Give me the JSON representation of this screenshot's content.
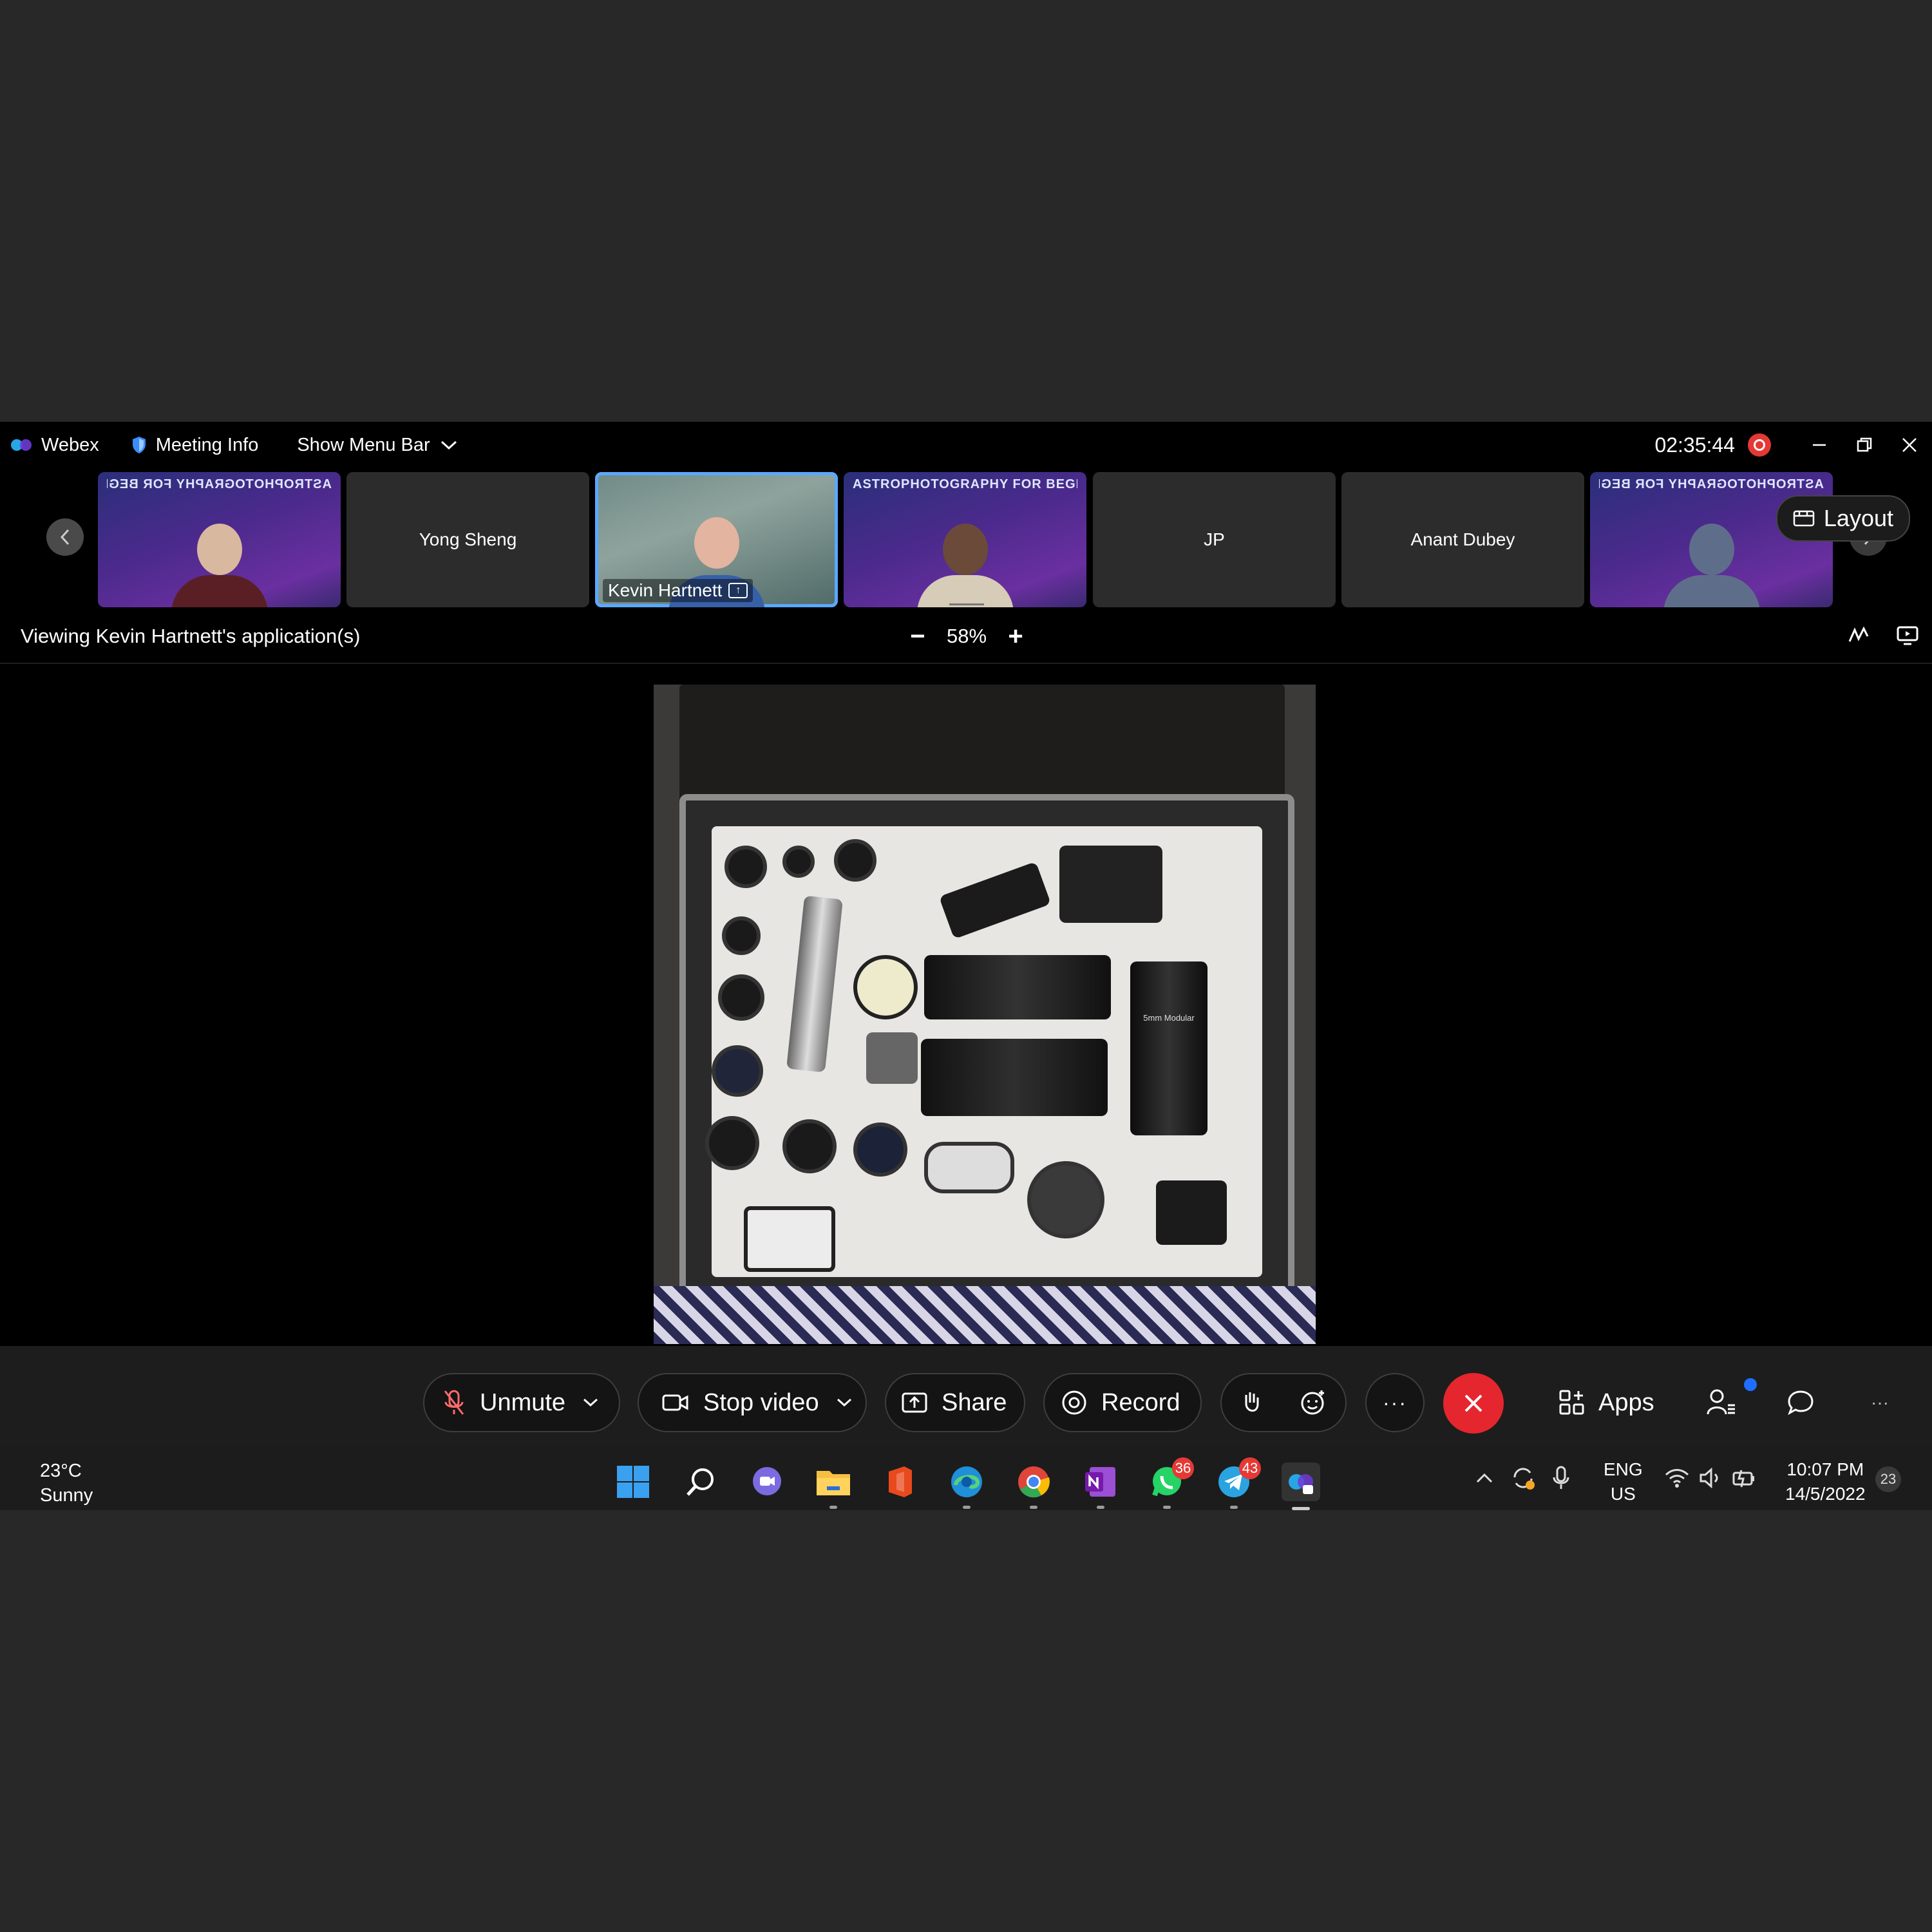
{
  "titlebar": {
    "app": "Webex",
    "meeting_info": "Meeting Info",
    "show_menu_bar": "Show Menu Bar",
    "timer": "02:35:44"
  },
  "participants": {
    "tiles": [
      {
        "name": "",
        "banner": "ASTROPHOTOGRAPHY FOR BEGINNERS",
        "video": true
      },
      {
        "name": "Yong Sheng",
        "video": false
      },
      {
        "name": "Kevin Hartnett",
        "video": true,
        "active": true,
        "sharing": true
      },
      {
        "name": "",
        "banner": "ASTROPHOTOGRAPHY FOR BEGINNERS",
        "video": true
      },
      {
        "name": "JP",
        "video": false
      },
      {
        "name": "Anant Dubey",
        "video": false
      },
      {
        "name": "",
        "banner": "ASTROPHOTOGRAPHY FOR BEGINNERS",
        "video": true
      }
    ],
    "layout_label": "Layout"
  },
  "viewing": {
    "text": "Viewing Kevin Hartnett's application(s)",
    "zoom": "58%",
    "zoom_minus": "−",
    "zoom_plus": "+"
  },
  "shared_content": {
    "printed_text": "5mm Modular"
  },
  "controls": {
    "unmute": "Unmute",
    "stop_video": "Stop video",
    "share": "Share",
    "record": "Record",
    "more": "···",
    "apps": "Apps",
    "overflow": "···"
  },
  "taskbar": {
    "temperature": "23°C",
    "weather": "Sunny",
    "whatsapp_badge": "36",
    "telegram_badge": "43",
    "lang_top": "ENG",
    "lang_bottom": "US",
    "time": "10:07 PM",
    "date": "14/5/2022",
    "notification_count": "23"
  },
  "colors": {
    "end_call": "#e5262e",
    "active_border": "#5aa8ff",
    "record_dot": "#e53935"
  }
}
